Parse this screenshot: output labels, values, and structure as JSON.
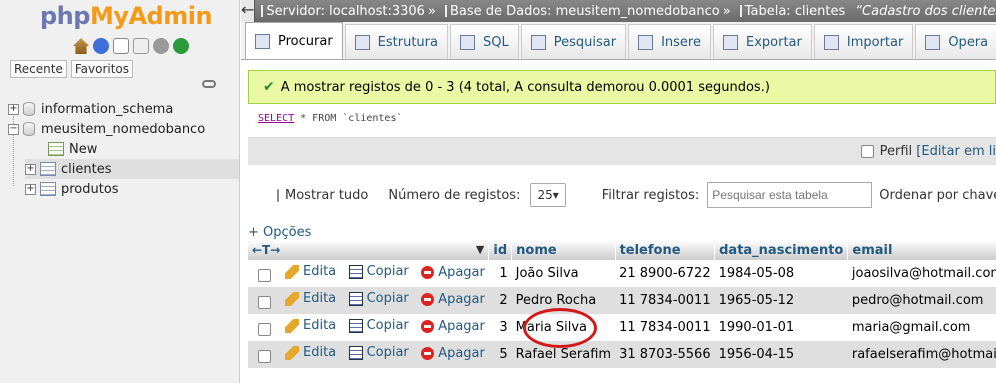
{
  "left": {
    "logo_php": "php",
    "logo_myadmin": "MyAdmin",
    "tabs": [
      "Recente",
      "Favoritos"
    ],
    "tree": [
      {
        "label": "information_schema"
      },
      {
        "label": "meusitem_nomedobanco"
      },
      {
        "label": "New"
      },
      {
        "label": "clientes"
      },
      {
        "label": "produtos"
      }
    ]
  },
  "breadcrumb": {
    "server": "Servidor: localhost:3306",
    "database": "Base de Dados: meusitem_nomedobanco",
    "table": "Tabela: clientes",
    "comment": "“Cadastro dos clientes d"
  },
  "menu": [
    "Procurar",
    "Estrutura",
    "SQL",
    "Pesquisar",
    "Insere",
    "Exportar",
    "Importar",
    "Opera"
  ],
  "message": "A mostrar registos de 0 - 3 (4 total, A consulta demorou 0.0001 segundos.)",
  "sql": {
    "kw": "SELECT",
    "rest": " * FROM `clientes`"
  },
  "profile": {
    "label": "Perfil",
    "edit_link": "[Editar em li"
  },
  "nav": {
    "show_all": "Mostrar tudo",
    "rows_label": "Número de registos:",
    "rows_value": "25",
    "filter_label": "Filtrar registos:",
    "filter_placeholder": "Pesquisar esta tabela",
    "sort_label": "Ordenar por chave"
  },
  "options_link": "+ Opções",
  "columns": [
    "id",
    "nome",
    "telefone",
    "data_nascimento",
    "email"
  ],
  "actions": {
    "edit": "Edita",
    "copy": "Copiar",
    "delete": "Apagar"
  },
  "rows": [
    {
      "id": "1",
      "nome": "João Silva",
      "telefone": "21 8900-6722",
      "data_nascimento": "1984-05-08",
      "email": "joaosilva@hotmail.com"
    },
    {
      "id": "2",
      "nome": "Pedro Rocha",
      "telefone": "11 7834-0011",
      "data_nascimento": "1965-05-12",
      "email": "pedro@hotmail.com"
    },
    {
      "id": "3",
      "nome": "Maria Silva",
      "telefone": "11 7834-0011",
      "data_nascimento": "1990-01-01",
      "email": "maria@gmail.com"
    },
    {
      "id": "5",
      "nome": "Rafael Serafim",
      "telefone": "31 8703-5566",
      "data_nascimento": "1956-04-15",
      "email": "rafaelserafim@hotmail.com"
    }
  ],
  "colors": {
    "accent": "#235a81",
    "success_bg": "#ebf8a4",
    "highlight_circle": "#d4181a"
  }
}
